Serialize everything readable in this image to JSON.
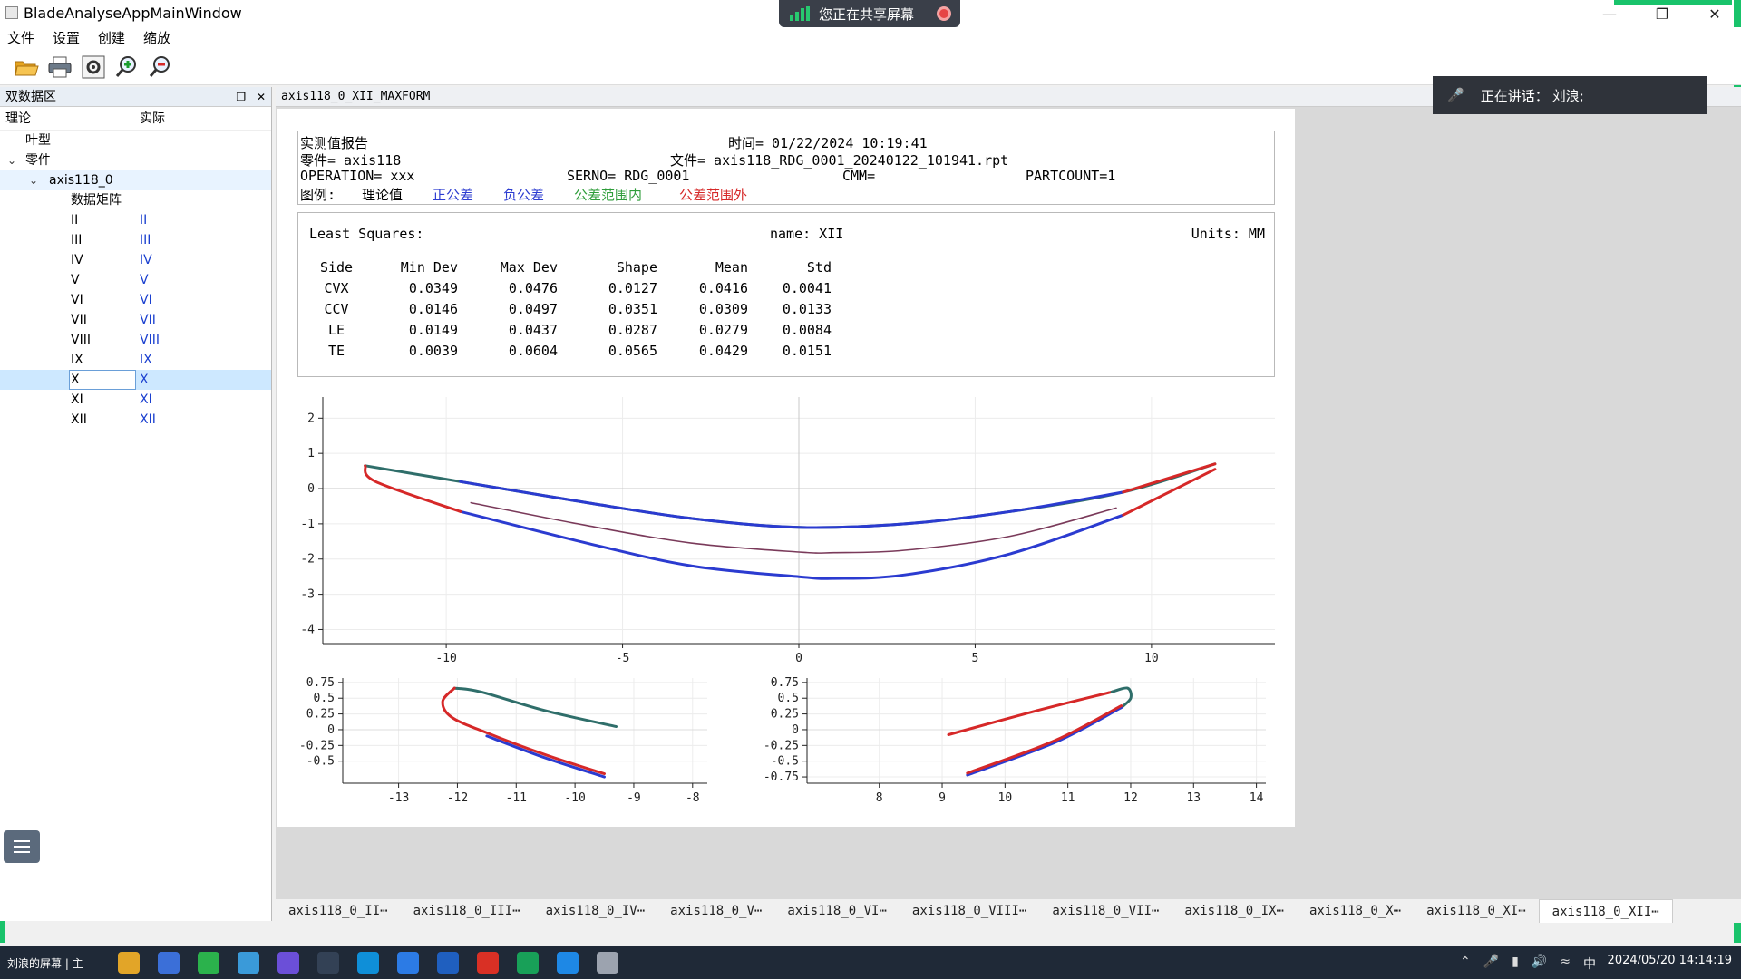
{
  "window": {
    "title": "BladeAnalyseAppMainWindow"
  },
  "share_banner": {
    "label": "您正在共享屏幕"
  },
  "speaking": {
    "label": "正在讲话：",
    "name": "刘浪;"
  },
  "menu": [
    "文件",
    "设置",
    "创建",
    "缩放"
  ],
  "toolbar": [
    "open-folder-icon",
    "print-icon",
    "settings-icon",
    "zoom-in-icon",
    "zoom-out-icon"
  ],
  "left_panel": {
    "title": "双数据区",
    "col_theory": "理论",
    "col_actual": "实际",
    "node_blade": "叶型",
    "node_part": "零件",
    "node_axis": "axis118_0",
    "node_matrix": "数据矩阵",
    "sections": [
      {
        "a": "II",
        "b": "II"
      },
      {
        "a": "III",
        "b": "III"
      },
      {
        "a": "IV",
        "b": "IV"
      },
      {
        "a": "V",
        "b": "V"
      },
      {
        "a": "VI",
        "b": "VI"
      },
      {
        "a": "VII",
        "b": "VII"
      },
      {
        "a": "VIII",
        "b": "VIII"
      },
      {
        "a": "IX",
        "b": "IX"
      },
      {
        "a": "X",
        "b": "X"
      },
      {
        "a": "XI",
        "b": "XI"
      },
      {
        "a": "XII",
        "b": "XII"
      }
    ]
  },
  "content_tab": "axis118_0_XII_MAXFORM",
  "report": {
    "header": {
      "title": "实测值报告",
      "time": "时间= 01/22/2024 10:19:41",
      "part": "零件= axis118",
      "file": "文件= axis118_RDG_0001_20240122_101941.rpt",
      "operation": "OPERATION= xxx",
      "serno": "SERNO= RDG_0001",
      "cmm": "CMM=",
      "partcount": "PARTCOUNT=1",
      "legend_label": "图例:",
      "legend": [
        {
          "text": "理论值",
          "color": "#000000"
        },
        {
          "text": "正公差",
          "color": "#2b3bd0"
        },
        {
          "text": "负公差",
          "color": "#2b3bd0"
        },
        {
          "text": "公差范围内",
          "color": "#2e9d3a"
        },
        {
          "text": "公差范围外",
          "color": "#d62828"
        }
      ]
    },
    "stats": {
      "method": "Least Squares:",
      "name": "name: XII",
      "units": "Units: MM",
      "columns": [
        "Side",
        "Min Dev",
        "Max Dev",
        "Shape",
        "Mean",
        "Std"
      ],
      "rows": [
        [
          "CVX",
          "0.0349",
          "0.0476",
          "0.0127",
          "0.0416",
          "0.0041"
        ],
        [
          "CCV",
          "0.0146",
          "0.0497",
          "0.0351",
          "0.0309",
          "0.0133"
        ],
        [
          "LE",
          "0.0149",
          "0.0437",
          "0.0287",
          "0.0279",
          "0.0084"
        ],
        [
          "TE",
          "0.0039",
          "0.0604",
          "0.0565",
          "0.0429",
          "0.0151"
        ]
      ]
    }
  },
  "chart_data": [
    {
      "type": "line",
      "xlim": [
        -13.5,
        13.5
      ],
      "ylim": [
        -4.4,
        2.6
      ],
      "x_ticks": [
        "-10",
        "-5",
        "0",
        "5",
        "10"
      ],
      "x_tick_values": [
        -10,
        -5,
        0,
        5,
        10
      ],
      "y_ticks": [
        "2",
        "1",
        "0",
        "-1",
        "-2",
        "-3",
        "-4"
      ],
      "y_tick_values": [
        2,
        1,
        0,
        -1,
        -2,
        -3,
        -4
      ],
      "grid": true,
      "series": [
        {
          "color": "#2f6e6a",
          "x": [
            -12.3,
            -9.6,
            -6,
            -3,
            0,
            3,
            6,
            9.2,
            11.8
          ],
          "y": [
            0.65,
            0.2,
            -0.4,
            -0.85,
            -1.1,
            -1.0,
            -0.65,
            -0.1,
            0.7
          ]
        },
        {
          "color": "#2b3bd0",
          "x": [
            -9.6,
            -6,
            -3,
            0,
            3,
            6,
            9.2
          ],
          "y": [
            0.2,
            -0.4,
            -0.85,
            -1.1,
            -1.0,
            -0.65,
            -0.1
          ]
        },
        {
          "color": "#2b3bd0",
          "x": [
            -9.6,
            -6,
            -3,
            0,
            1,
            3,
            6,
            9.2
          ],
          "y": [
            -0.65,
            -1.55,
            -2.2,
            -2.5,
            -2.55,
            -2.45,
            -1.85,
            -0.75
          ]
        },
        {
          "color": "#7a3a5a",
          "x": [
            -9.3,
            -6,
            -3,
            0,
            1,
            3,
            6,
            9.0
          ],
          "y": [
            -0.4,
            -1.05,
            -1.55,
            -1.8,
            -1.82,
            -1.75,
            -1.35,
            -0.55
          ]
        },
        {
          "color": "#d62828",
          "x": [
            -12.3,
            -12.0,
            -9.6
          ],
          "y": [
            0.65,
            0.2,
            -0.65
          ]
        },
        {
          "color": "#d62828",
          "x": [
            9.2,
            11.8
          ],
          "y": [
            -0.1,
            0.7
          ]
        },
        {
          "color": "#d62828",
          "x": [
            9.2,
            11.8
          ],
          "y": [
            -0.75,
            0.55
          ]
        }
      ]
    },
    {
      "type": "line",
      "xlim": [
        -13.95,
        -7.75
      ],
      "ylim": [
        -0.85,
        0.82
      ],
      "x_ticks": [
        "-13",
        "-12",
        "-11",
        "-10",
        "-9",
        "-8"
      ],
      "x_tick_values": [
        -13,
        -12,
        -11,
        -10,
        -9,
        -8
      ],
      "y_ticks": [
        "0.75",
        "0.5",
        "0.25",
        "0",
        "-0.25",
        "-0.5"
      ],
      "y_tick_values": [
        0.75,
        0.5,
        0.25,
        0,
        -0.25,
        -0.5
      ],
      "grid": true,
      "series": [
        {
          "color": "#2f6e6a",
          "x": [
            -12.05,
            -11.6,
            -10.5,
            -9.3
          ],
          "y": [
            0.66,
            0.6,
            0.3,
            0.05
          ]
        },
        {
          "color": "#d62828",
          "x": [
            -12.05,
            -12.25,
            -12.1,
            -11.5,
            -10.5,
            -9.5
          ],
          "y": [
            0.66,
            0.45,
            0.2,
            -0.05,
            -0.4,
            -0.7
          ]
        },
        {
          "color": "#2b3bd0",
          "x": [
            -11.5,
            -10.5,
            -9.5
          ],
          "y": [
            -0.1,
            -0.45,
            -0.75
          ]
        }
      ]
    },
    {
      "type": "line",
      "xlim": [
        6.85,
        14.15
      ],
      "ylim": [
        -0.85,
        0.82
      ],
      "x_ticks": [
        "8",
        "9",
        "10",
        "11",
        "12",
        "13",
        "14"
      ],
      "x_tick_values": [
        8,
        9,
        10,
        11,
        12,
        13,
        14
      ],
      "y_ticks": [
        "0.75",
        "0.5",
        "0.25",
        "0",
        "-0.25",
        "-0.5",
        "-0.75"
      ],
      "y_tick_values": [
        0.75,
        0.5,
        0.25,
        0,
        -0.25,
        -0.5,
        -0.75
      ],
      "grid": true,
      "series": [
        {
          "color": "#d62828",
          "x": [
            9.1,
            10.5,
            11.7
          ],
          "y": [
            -0.08,
            0.3,
            0.6
          ]
        },
        {
          "color": "#2f6e6a",
          "x": [
            11.7,
            11.95,
            12.0,
            11.85
          ],
          "y": [
            0.6,
            0.66,
            0.5,
            0.35
          ]
        },
        {
          "color": "#2b3bd0",
          "x": [
            11.85,
            10.8,
            9.4
          ],
          "y": [
            0.35,
            -0.2,
            -0.72
          ]
        },
        {
          "color": "#d62828",
          "x": [
            11.85,
            10.8,
            9.4
          ],
          "y": [
            0.38,
            -0.17,
            -0.69
          ]
        }
      ]
    }
  ],
  "doc_tabs": [
    "axis118_0_II⋯",
    "axis118_0_III⋯",
    "axis118_0_IV⋯",
    "axis118_0_V⋯",
    "axis118_0_VI⋯",
    "axis118_0_VIII⋯",
    "axis118_0_VII⋯",
    "axis118_0_IX⋯",
    "axis118_0_X⋯",
    "axis118_0_XI⋯",
    "axis118_0_XII⋯"
  ],
  "taskbar": {
    "overlay": "刘浪的屏幕 | 主",
    "ime": "中",
    "clock": "2024/05/20 14:14:19"
  }
}
